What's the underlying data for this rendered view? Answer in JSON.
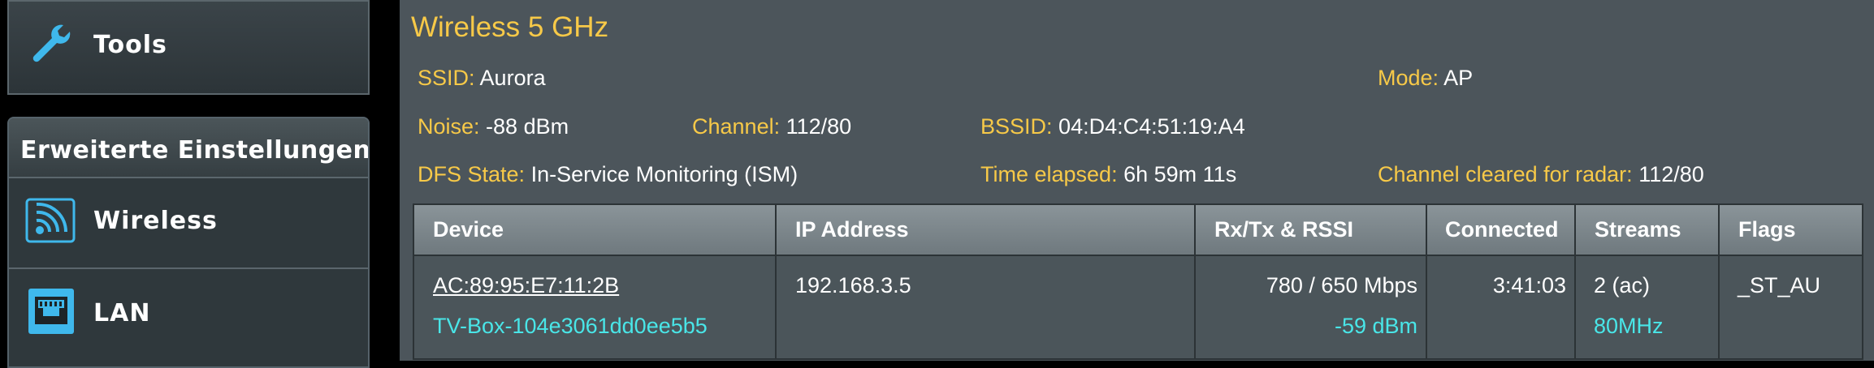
{
  "sidebar": {
    "tools_label": "Tools",
    "advanced_title": "Erweiterte Einstellungen",
    "items": [
      {
        "label": "Wireless",
        "icon": "wireless-router-icon"
      },
      {
        "label": "LAN",
        "icon": "lan-port-icon"
      }
    ]
  },
  "main": {
    "title": "Wireless 5 GHz",
    "info": {
      "ssid": {
        "key": "SSID:",
        "value": "Aurora"
      },
      "mode": {
        "key": "Mode:",
        "value": "AP"
      },
      "noise": {
        "key": "Noise:",
        "value": "-88 dBm"
      },
      "channel": {
        "key": "Channel:",
        "value": "112/80"
      },
      "bssid": {
        "key": "BSSID:",
        "value": "04:D4:C4:51:19:A4"
      },
      "dfs_state": {
        "key": "DFS State:",
        "value": "In-Service Monitoring (ISM)"
      },
      "time_elapsed": {
        "key": "Time elapsed:",
        "value": "6h 59m 11s"
      },
      "channel_cleared": {
        "key": "Channel cleared for radar:",
        "value": "112/80"
      }
    },
    "table": {
      "headers": [
        "Device",
        "IP Address",
        "Rx/Tx & RSSI",
        "Connected",
        "Streams",
        "Flags"
      ],
      "rows": [
        {
          "mac": "AC:89:95:E7:11:2B",
          "hostname": "TV-Box-104e3061dd0ee5b5",
          "ip": "192.168.3.5",
          "rxtx": "780 / 650 Mbps",
          "rssi": "-59 dBm",
          "connected": "3:41:03",
          "streams": "2 (ac)",
          "bandwidth": "80MHz",
          "flags": "_ST_AU"
        }
      ]
    }
  },
  "colors": {
    "accent": "#f7c948",
    "cyan": "#49e6e8",
    "panel": "#4c555b"
  }
}
